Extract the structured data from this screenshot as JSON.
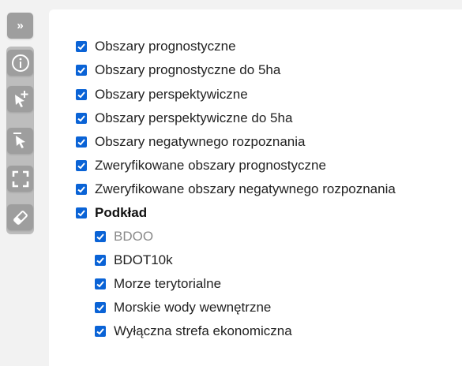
{
  "toolbar": {
    "collapse_label": "»",
    "tools": [
      {
        "name": "info-icon"
      },
      {
        "name": "add-selection-icon"
      },
      {
        "name": "remove-selection-icon"
      },
      {
        "name": "fullscreen-icon"
      },
      {
        "name": "eraser-icon"
      }
    ]
  },
  "layers": [
    {
      "label": "Obszary prognostyczne",
      "checked": true
    },
    {
      "label": "Obszary prognostyczne do 5ha",
      "checked": true
    },
    {
      "label": "Obszary perspektywiczne",
      "checked": true
    },
    {
      "label": "Obszary perspektywiczne do 5ha",
      "checked": true
    },
    {
      "label": "Obszary negatywnego rozpoznania",
      "checked": true
    },
    {
      "label": "Zweryfikowane obszary prognostyczne",
      "checked": true
    },
    {
      "label": "Zweryfikowane obszary negatywnego rozpoznania",
      "checked": true
    }
  ],
  "basemap": {
    "label": "Podkład",
    "checked": true,
    "children": [
      {
        "label": "BDOO",
        "checked": true,
        "disabled": true
      },
      {
        "label": "BDOT10k",
        "checked": true
      },
      {
        "label": "Morze terytorialne",
        "checked": true
      },
      {
        "label": "Morskie wody wewnętrzne",
        "checked": true
      },
      {
        "label": "Wyłączna strefa ekonomiczna",
        "checked": true
      }
    ]
  },
  "colors": {
    "checkbox": "#0a63d6",
    "tool_button": "#9e9e9e",
    "tool_group": "#bdbdbd"
  }
}
